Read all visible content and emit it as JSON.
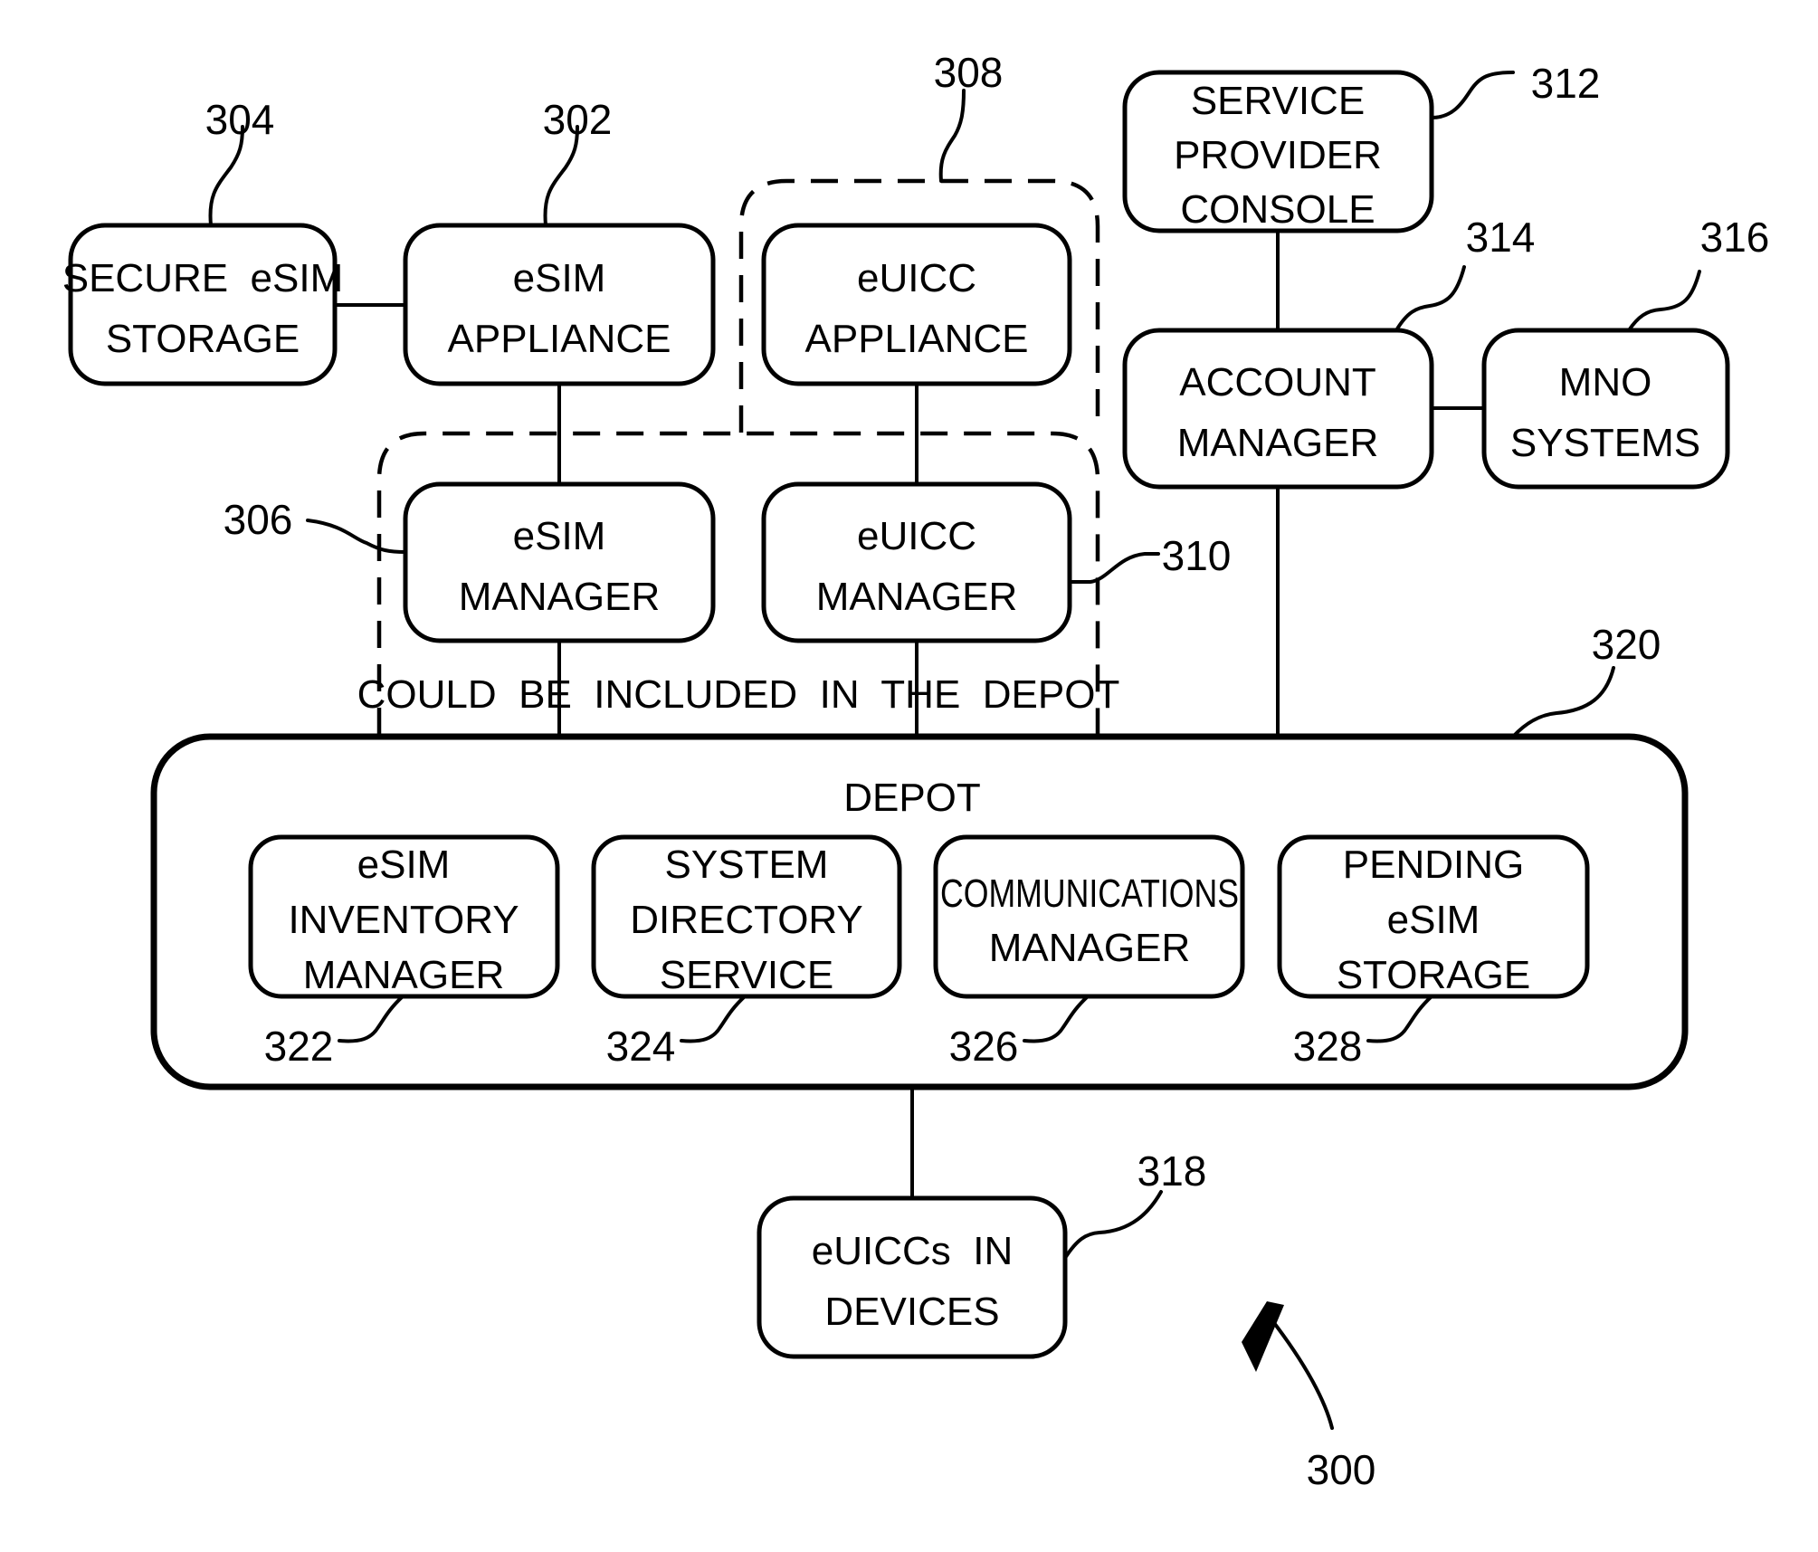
{
  "figure": {
    "number": "300",
    "colors": {
      "line": "#000000",
      "background": "#ffffff"
    }
  },
  "blocks": {
    "secure_esim_storage": {
      "ref": "304",
      "lines": [
        "SECURE  eSIM",
        "STORAGE"
      ]
    },
    "esim_appliance": {
      "ref": "302",
      "lines": [
        "eSIM",
        "APPLIANCE"
      ]
    },
    "euicc_appliance": {
      "ref": "308",
      "lines": [
        "eUICC",
        "APPLIANCE"
      ]
    },
    "esim_manager": {
      "ref": "306",
      "lines": [
        "eSIM",
        "MANAGER"
      ]
    },
    "euicc_manager": {
      "ref": "310",
      "lines": [
        "eUICC",
        "MANAGER"
      ]
    },
    "service_provider_console": {
      "ref": "312",
      "lines": [
        "SERVICE",
        "PROVIDER",
        "CONSOLE"
      ]
    },
    "account_manager": {
      "ref": "314",
      "lines": [
        "ACCOUNT",
        "MANAGER"
      ]
    },
    "mno_systems": {
      "ref": "316",
      "lines": [
        "MNO",
        "SYSTEMS"
      ]
    },
    "euiccs_in_devices": {
      "ref": "318",
      "lines": [
        "eUICCs  IN",
        "DEVICES"
      ]
    }
  },
  "depot": {
    "ref": "320",
    "title": "DEPOT",
    "components": [
      {
        "ref": "322",
        "lines": [
          "eSIM",
          "INVENTORY",
          "MANAGER"
        ]
      },
      {
        "ref": "324",
        "lines": [
          "SYSTEM",
          "DIRECTORY",
          "SERVICE"
        ]
      },
      {
        "ref": "326",
        "lines": [
          "COMMUNICATIONS",
          "MANAGER"
        ]
      },
      {
        "ref": "328",
        "lines": [
          "PENDING",
          "eSIM",
          "STORAGE"
        ]
      }
    ]
  },
  "optional_group_note": "COULD  BE  INCLUDED  IN  THE  DEPOT"
}
